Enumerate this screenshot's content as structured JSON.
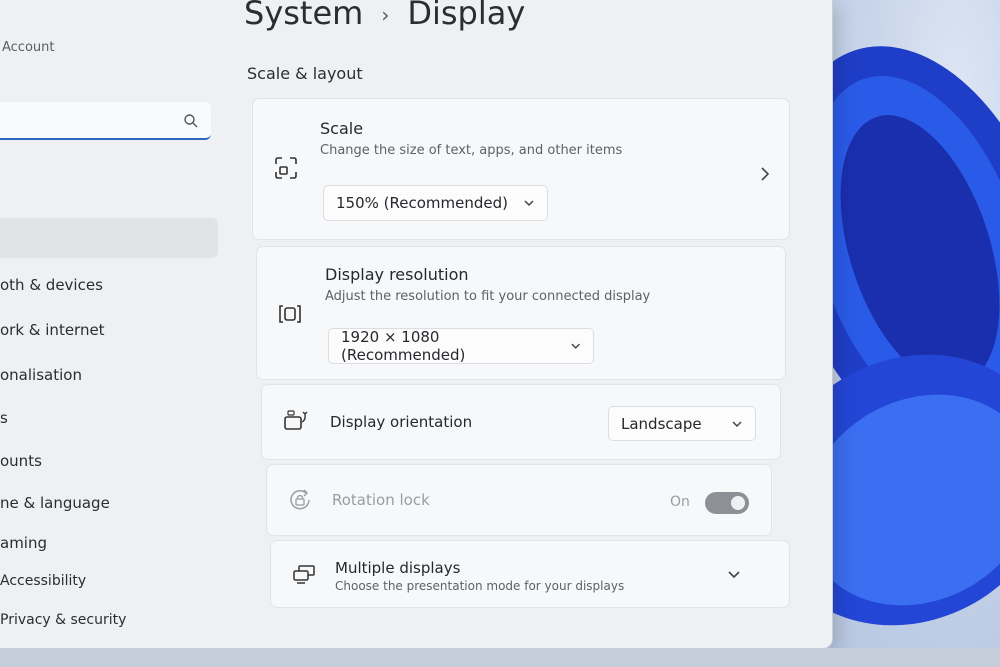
{
  "header": {
    "parent": "System",
    "current": "Display"
  },
  "sidebar": {
    "account_label": "Account",
    "items": [
      {
        "label": "oth & devices"
      },
      {
        "label": "ork & internet"
      },
      {
        "label": "onalisation"
      },
      {
        "label": "s"
      },
      {
        "label": "ounts"
      },
      {
        "label": "ne & language"
      },
      {
        "label": "aming"
      },
      {
        "label": "Accessibility"
      },
      {
        "label": "Privacy & security"
      }
    ]
  },
  "section": {
    "title": "Scale & layout"
  },
  "scale": {
    "title": "Scale",
    "subtitle": "Change the size of text, apps, and other items",
    "value": "150% (Recommended)"
  },
  "resolution": {
    "title": "Display resolution",
    "subtitle": "Adjust the resolution to fit your connected display",
    "value": "1920 × 1080 (Recommended)"
  },
  "orientation": {
    "title": "Display orientation",
    "value": "Landscape"
  },
  "rotation_lock": {
    "title": "Rotation lock",
    "state_label": "On",
    "enabled": false,
    "on": true
  },
  "multiple_displays": {
    "title": "Multiple displays",
    "subtitle": "Choose the presentation mode for your displays"
  },
  "colors": {
    "accent": "#2f66c4",
    "window_bg": "#eef0f3",
    "card_bg": "#f7f8fa"
  }
}
